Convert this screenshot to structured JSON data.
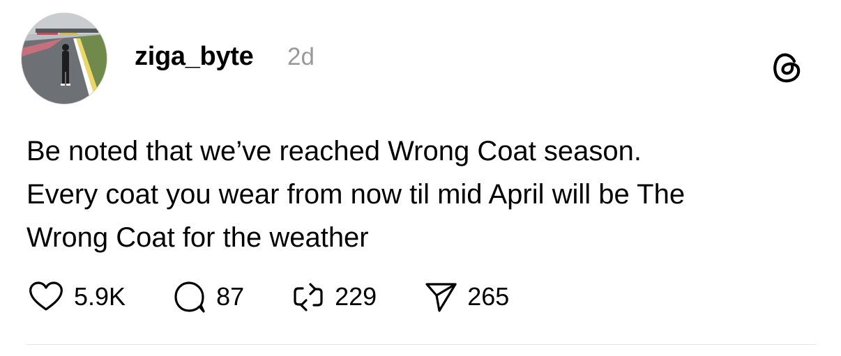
{
  "post": {
    "username": "ziga_byte",
    "time": "2d",
    "text_lines": [
      "Be noted that we’ve reached Wrong Coat season.",
      "Every coat you wear from now til mid April will be The",
      "Wrong Coat for the weather"
    ]
  },
  "actions": {
    "likes": "5.9K",
    "replies": "87",
    "reposts": "229",
    "shares": "265"
  },
  "icons": {
    "avatar": "avatar-photo",
    "logo": "threads-logo-icon",
    "like": "heart-icon",
    "reply": "comment-icon",
    "repost": "repost-icon",
    "share": "send-icon"
  },
  "colors": {
    "text": "#000000",
    "muted": "#999999",
    "divider": "#e6e6e6"
  }
}
